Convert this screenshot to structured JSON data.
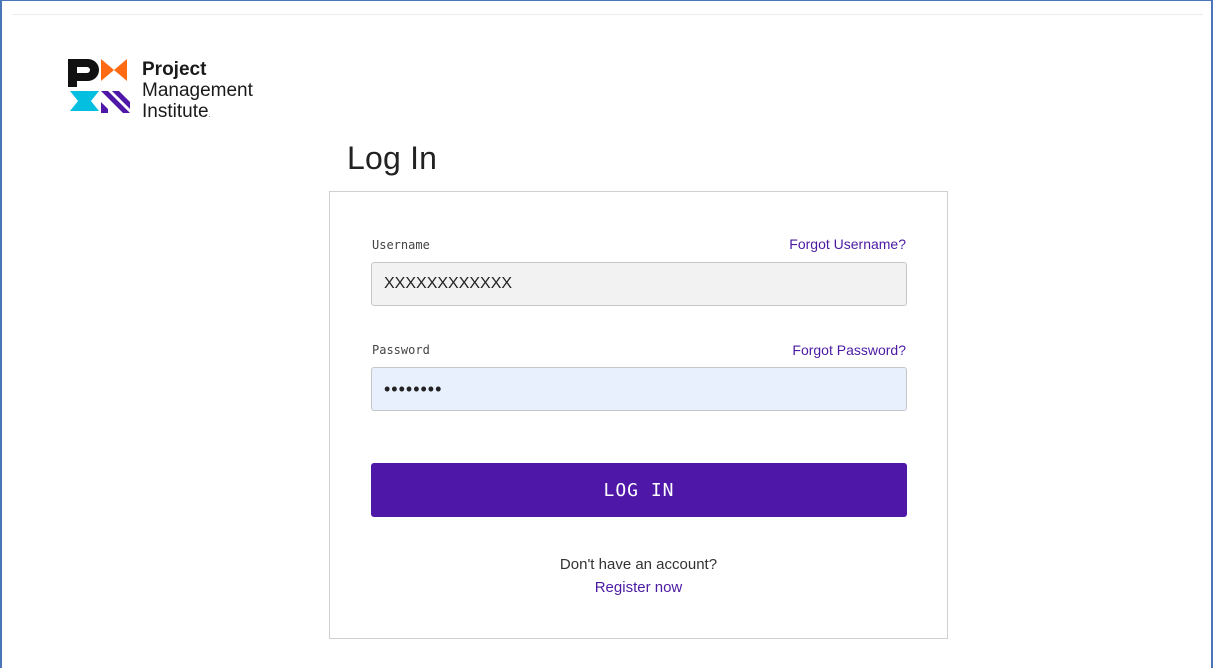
{
  "brand": {
    "line1": "Project",
    "line2": "Management",
    "line3": "Institute",
    "colors": {
      "black": "#111111",
      "orange": "#ff6a13",
      "cyan": "#05bfe0",
      "purple": "#4f17a8"
    }
  },
  "page": {
    "title": "Log In"
  },
  "form": {
    "username": {
      "label": "Username",
      "forgot_link": "Forgot Username?",
      "value": "XXXXXXXXXXXX"
    },
    "password": {
      "label": "Password",
      "forgot_link": "Forgot Password?",
      "value": "••••••••"
    },
    "submit_label": "LOG IN",
    "no_account_text": "Don't have an account?",
    "register_link": "Register now"
  },
  "colors": {
    "accent": "#4f17a8",
    "link": "#4b1aa3",
    "username_bg": "#f2f2f2",
    "password_bg": "#e8f0fe"
  }
}
